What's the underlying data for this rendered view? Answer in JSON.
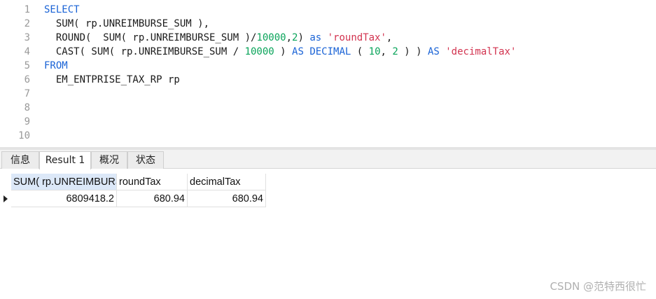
{
  "editor": {
    "line_numbers": [
      "1",
      "2",
      "3",
      "4",
      "5",
      "6",
      "7",
      "8",
      "9",
      "10"
    ],
    "lines": [
      [
        {
          "t": "SELECT",
          "c": "kw"
        }
      ],
      [
        {
          "t": "  SUM( rp.UNREIMBURSE_SUM ),",
          "c": ""
        }
      ],
      [
        {
          "t": "  ROUND(  SUM( rp.UNREIMBURSE_SUM )/",
          "c": ""
        },
        {
          "t": "10000",
          "c": "num"
        },
        {
          "t": ",",
          "c": ""
        },
        {
          "t": "2",
          "c": "num"
        },
        {
          "t": ") ",
          "c": ""
        },
        {
          "t": "as",
          "c": "kw"
        },
        {
          "t": " ",
          "c": ""
        },
        {
          "t": "'roundTax'",
          "c": "str"
        },
        {
          "t": ",",
          "c": ""
        }
      ],
      [
        {
          "t": "  CAST( SUM( rp.UNREIMBURSE_SUM / ",
          "c": ""
        },
        {
          "t": "10000",
          "c": "num"
        },
        {
          "t": " ) ",
          "c": ""
        },
        {
          "t": "AS",
          "c": "kw"
        },
        {
          "t": " ",
          "c": ""
        },
        {
          "t": "DECIMAL",
          "c": "kw"
        },
        {
          "t": " ( ",
          "c": ""
        },
        {
          "t": "10",
          "c": "num"
        },
        {
          "t": ", ",
          "c": ""
        },
        {
          "t": "2",
          "c": "num"
        },
        {
          "t": " ) ) ",
          "c": ""
        },
        {
          "t": "AS",
          "c": "kw"
        },
        {
          "t": " ",
          "c": ""
        },
        {
          "t": "'decimalTax'",
          "c": "str"
        }
      ],
      [
        {
          "t": "FROM",
          "c": "kw"
        }
      ],
      [
        {
          "t": "  EM_ENTPRISE_TAX_RP rp",
          "c": ""
        }
      ],
      [],
      [],
      [],
      []
    ]
  },
  "tabs": [
    "信息",
    "Result 1",
    "概况",
    "状态"
  ],
  "result": {
    "columns": [
      "SUM( rp.UNREIMBURSE_SUM )",
      "roundTax",
      "decimalTax"
    ],
    "rows": [
      [
        "6809418.2",
        "680.94",
        "680.94"
      ]
    ]
  },
  "watermark": "CSDN @范特西很忙",
  "colors": {
    "keyword": "#1a63d6",
    "number": "#0aa45a",
    "string": "#d2334f",
    "selected_header": "#dce8f8"
  }
}
